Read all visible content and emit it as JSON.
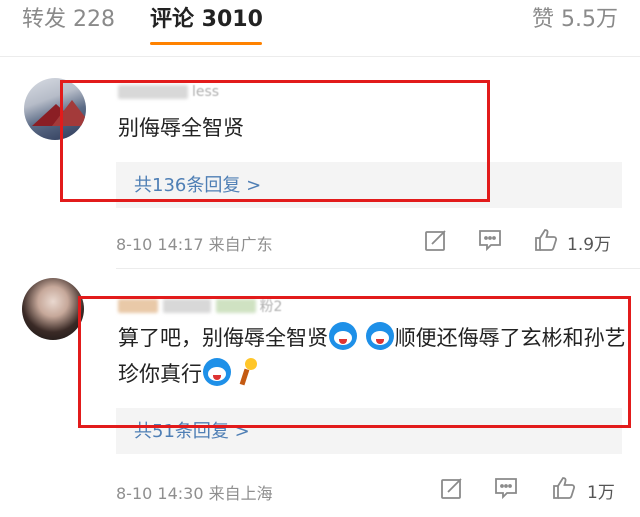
{
  "tabs": {
    "repost": "转发 228",
    "comments": "评论 3010",
    "likes": "赞 5.5万"
  },
  "comments": [
    {
      "username_suffix": "less",
      "text": "别侮辱全智贤",
      "replies": "共136条回复 >",
      "time": "8-10 14:17",
      "location": "来自广东",
      "like_count": "1.9万"
    },
    {
      "username_suffix": "粉2",
      "text_part1": "算了吧，别侮辱全智贤",
      "text_part2": "顺便还侮辱了玄彬和孙艺珍你真行",
      "replies": "共51条回复 >",
      "time": "8-10 14:30",
      "location": "来自上海",
      "like_count": "1万"
    }
  ],
  "icons": {
    "share": "edit-share-icon",
    "reply": "comment-bubble-icon",
    "like": "thumbs-up-icon",
    "emoji": "doraemon-emoji-icon",
    "torch": "torch-emoji-icon"
  },
  "colors": {
    "accent": "#ff8200",
    "link": "#4f7fb5",
    "highlight": "#e21b1b"
  }
}
